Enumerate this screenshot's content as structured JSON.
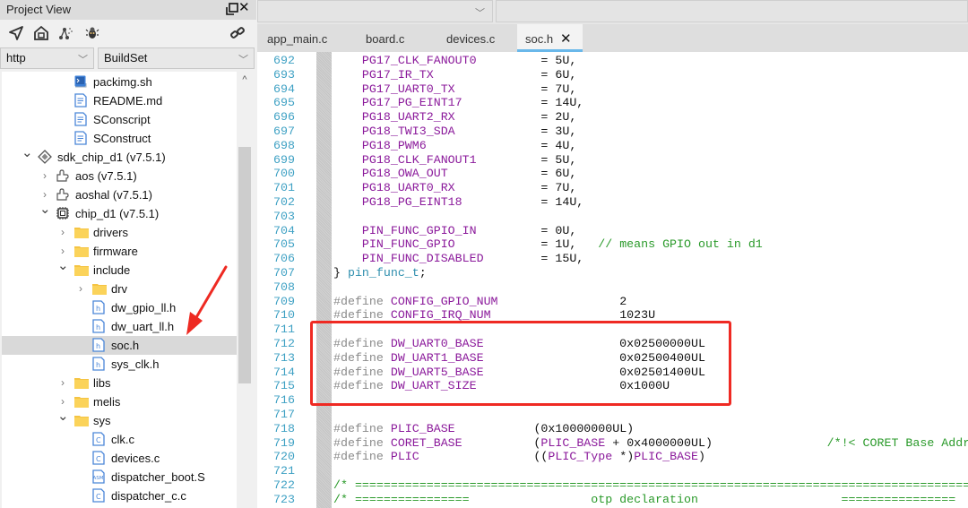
{
  "project_view": {
    "title": "Project View",
    "toolbar_icons": [
      "locate-icon",
      "home-icon",
      "graph-icon",
      "bug-icon",
      "link-icon"
    ],
    "combo_left": "http",
    "combo_right": "BuildSet",
    "tree": [
      {
        "label": "packimg.sh",
        "icon": "shell-file-icon",
        "indent": 3,
        "twisty": ""
      },
      {
        "label": "README.md",
        "icon": "text-file-icon",
        "indent": 3,
        "twisty": ""
      },
      {
        "label": "SConscript",
        "icon": "text-file-icon",
        "indent": 3,
        "twisty": ""
      },
      {
        "label": "SConstruct",
        "icon": "text-file-icon",
        "indent": 3,
        "twisty": ""
      },
      {
        "label": "sdk_chip_d1 (v7.5.1)",
        "icon": "sdk-icon",
        "indent": 1,
        "twisty": "expanded"
      },
      {
        "label": "aos (v7.5.1)",
        "icon": "component-icon",
        "indent": 2,
        "twisty": "collapsed"
      },
      {
        "label": "aoshal (v7.5.1)",
        "icon": "component-icon",
        "indent": 2,
        "twisty": "collapsed"
      },
      {
        "label": "chip_d1 (v7.5.1)",
        "icon": "chip-icon",
        "indent": 2,
        "twisty": "expanded"
      },
      {
        "label": "drivers",
        "icon": "folder-icon",
        "indent": 3,
        "twisty": "collapsed"
      },
      {
        "label": "firmware",
        "icon": "folder-icon",
        "indent": 3,
        "twisty": "collapsed"
      },
      {
        "label": "include",
        "icon": "folder-icon",
        "indent": 3,
        "twisty": "expanded"
      },
      {
        "label": "drv",
        "icon": "folder-icon",
        "indent": 4,
        "twisty": "collapsed"
      },
      {
        "label": "dw_gpio_ll.h",
        "icon": "header-file-icon",
        "indent": 4,
        "twisty": ""
      },
      {
        "label": "dw_uart_ll.h",
        "icon": "header-file-icon",
        "indent": 4,
        "twisty": ""
      },
      {
        "label": "soc.h",
        "icon": "header-file-icon",
        "indent": 4,
        "twisty": "",
        "selected": true
      },
      {
        "label": "sys_clk.h",
        "icon": "header-file-icon",
        "indent": 4,
        "twisty": ""
      },
      {
        "label": "libs",
        "icon": "folder-icon",
        "indent": 3,
        "twisty": "collapsed"
      },
      {
        "label": "melis",
        "icon": "folder-icon",
        "indent": 3,
        "twisty": "collapsed"
      },
      {
        "label": "sys",
        "icon": "folder-icon",
        "indent": 3,
        "twisty": "expanded"
      },
      {
        "label": "clk.c",
        "icon": "c-file-icon",
        "indent": 4,
        "twisty": ""
      },
      {
        "label": "devices.c",
        "icon": "c-file-icon",
        "indent": 4,
        "twisty": ""
      },
      {
        "label": "dispatcher_boot.S",
        "icon": "asm-file-icon",
        "indent": 4,
        "twisty": ""
      },
      {
        "label": "dispatcher_c.c",
        "icon": "c-file-icon",
        "indent": 4,
        "twisty": ""
      }
    ]
  },
  "editor": {
    "tabs": [
      {
        "label": "app_main.c",
        "active": false
      },
      {
        "label": "board.c",
        "active": false
      },
      {
        "label": "devices.c",
        "active": false
      },
      {
        "label": "soc.h",
        "active": true,
        "closable": true
      }
    ],
    "close_glyph": "✕",
    "lines": [
      {
        "n": "692",
        "tokens": [
          [
            "",
            "    "
          ],
          [
            "id",
            "PG17_CLK_FANOUT0"
          ],
          [
            "num",
            "         = 5U,"
          ]
        ]
      },
      {
        "n": "693",
        "tokens": [
          [
            "",
            "    "
          ],
          [
            "id",
            "PG17_IR_TX"
          ],
          [
            "num",
            "               = 6U,"
          ]
        ]
      },
      {
        "n": "694",
        "tokens": [
          [
            "",
            "    "
          ],
          [
            "id",
            "PG17_UART0_TX"
          ],
          [
            "num",
            "            = 7U,"
          ]
        ]
      },
      {
        "n": "695",
        "tokens": [
          [
            "",
            "    "
          ],
          [
            "id",
            "PG17_PG_EINT17"
          ],
          [
            "num",
            "           = 14U,"
          ]
        ]
      },
      {
        "n": "696",
        "tokens": [
          [
            "",
            "    "
          ],
          [
            "id",
            "PG18_UART2_RX"
          ],
          [
            "num",
            "            = 2U,"
          ]
        ]
      },
      {
        "n": "697",
        "tokens": [
          [
            "",
            "    "
          ],
          [
            "id",
            "PG18_TWI3_SDA"
          ],
          [
            "num",
            "            = 3U,"
          ]
        ]
      },
      {
        "n": "698",
        "tokens": [
          [
            "",
            "    "
          ],
          [
            "id",
            "PG18_PWM6"
          ],
          [
            "num",
            "                = 4U,"
          ]
        ]
      },
      {
        "n": "699",
        "tokens": [
          [
            "",
            "    "
          ],
          [
            "id",
            "PG18_CLK_FANOUT1"
          ],
          [
            "num",
            "         = 5U,"
          ]
        ]
      },
      {
        "n": "700",
        "tokens": [
          [
            "",
            "    "
          ],
          [
            "id",
            "PG18_OWA_OUT"
          ],
          [
            "num",
            "             = 6U,"
          ]
        ]
      },
      {
        "n": "701",
        "tokens": [
          [
            "",
            "    "
          ],
          [
            "id",
            "PG18_UART0_RX"
          ],
          [
            "num",
            "            = 7U,"
          ]
        ]
      },
      {
        "n": "702",
        "tokens": [
          [
            "",
            "    "
          ],
          [
            "id",
            "PG18_PG_EINT18"
          ],
          [
            "num",
            "           = 14U,"
          ]
        ]
      },
      {
        "n": "703",
        "tokens": []
      },
      {
        "n": "704",
        "tokens": [
          [
            "",
            "    "
          ],
          [
            "id",
            "PIN_FUNC_GPIO_IN"
          ],
          [
            "num",
            "         = 0U,"
          ]
        ]
      },
      {
        "n": "705",
        "tokens": [
          [
            "",
            "    "
          ],
          [
            "id",
            "PIN_FUNC_GPIO"
          ],
          [
            "num",
            "            = 1U,"
          ],
          [
            "cm",
            "   // means GPIO out in d1"
          ]
        ]
      },
      {
        "n": "706",
        "tokens": [
          [
            "",
            "    "
          ],
          [
            "id",
            "PIN_FUNC_DISABLED"
          ],
          [
            "num",
            "        = 15U,"
          ]
        ]
      },
      {
        "n": "707",
        "tokens": [
          [
            "num",
            "} "
          ],
          [
            "tp",
            "pin_func_t"
          ],
          [
            "num",
            ";"
          ]
        ]
      },
      {
        "n": "708",
        "tokens": []
      },
      {
        "n": "709",
        "tokens": [
          [
            "kw",
            "#define "
          ],
          [
            "id",
            "CONFIG_GPIO_NUM"
          ],
          [
            "num",
            "                 2"
          ]
        ]
      },
      {
        "n": "710",
        "tokens": [
          [
            "kw",
            "#define "
          ],
          [
            "id",
            "CONFIG_IRQ_NUM"
          ],
          [
            "num",
            "                  1023U"
          ]
        ]
      },
      {
        "n": "711",
        "tokens": []
      },
      {
        "n": "712",
        "tokens": [
          [
            "kw",
            "#define "
          ],
          [
            "id",
            "DW_UART0_BASE"
          ],
          [
            "num",
            "                   0x02500000UL"
          ]
        ]
      },
      {
        "n": "713",
        "tokens": [
          [
            "kw",
            "#define "
          ],
          [
            "id",
            "DW_UART1_BASE"
          ],
          [
            "num",
            "                   0x02500400UL"
          ]
        ]
      },
      {
        "n": "714",
        "tokens": [
          [
            "kw",
            "#define "
          ],
          [
            "id",
            "DW_UART5_BASE"
          ],
          [
            "num",
            "                   0x02501400UL"
          ]
        ]
      },
      {
        "n": "715",
        "tokens": [
          [
            "kw",
            "#define "
          ],
          [
            "id",
            "DW_UART_SIZE"
          ],
          [
            "num",
            "                    0x1000U"
          ]
        ]
      },
      {
        "n": "716",
        "tokens": []
      },
      {
        "n": "717",
        "tokens": []
      },
      {
        "n": "718",
        "tokens": [
          [
            "kw",
            "#define "
          ],
          [
            "id",
            "PLIC_BASE"
          ],
          [
            "num",
            "           (0x10000000UL)"
          ]
        ]
      },
      {
        "n": "719",
        "tokens": [
          [
            "kw",
            "#define "
          ],
          [
            "id",
            "CORET_BASE"
          ],
          [
            "num",
            "          ("
          ],
          [
            "id",
            "PLIC_BASE"
          ],
          [
            "num",
            " + 0x4000000UL)"
          ],
          [
            "cm",
            "                /*!< CORET Base Address */"
          ]
        ]
      },
      {
        "n": "720",
        "tokens": [
          [
            "kw",
            "#define "
          ],
          [
            "id",
            "PLIC"
          ],
          [
            "num",
            "                (("
          ],
          [
            "id",
            "PLIC_Type"
          ],
          [
            "num",
            " *)"
          ],
          [
            "id",
            "PLIC_BASE"
          ],
          [
            "num",
            ")"
          ]
        ]
      },
      {
        "n": "721",
        "tokens": []
      },
      {
        "n": "722",
        "tokens": [
          [
            "cm",
            "/* ============================================================================================="
          ]
        ]
      },
      {
        "n": "723",
        "tokens": [
          [
            "cm",
            "/* ================                 otp declaration                    ================"
          ]
        ]
      }
    ]
  },
  "annotation": {
    "highlight_color": "#ef2a23",
    "highlighted_lines": [
      "711",
      "716"
    ]
  }
}
